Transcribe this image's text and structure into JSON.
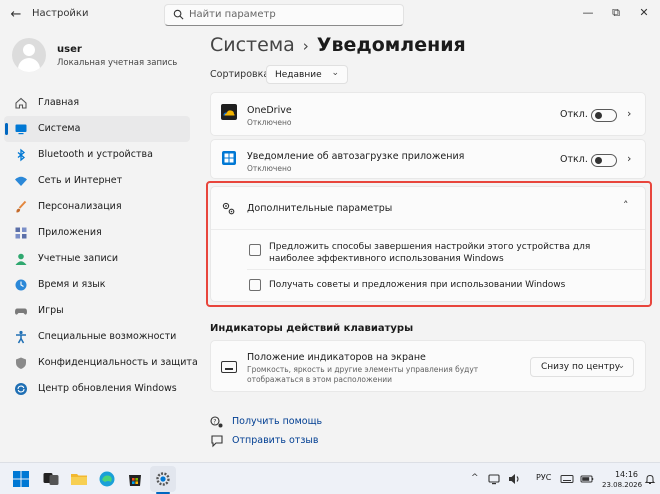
{
  "window": {
    "title": "Настройки",
    "search_placeholder": "Найти параметр",
    "controls": {
      "minimize": "—",
      "maximize": "⧉",
      "close": "✕"
    }
  },
  "user": {
    "name": "user",
    "account_type": "Локальная учетная запись"
  },
  "sidebar": {
    "items": [
      {
        "label": "Главная",
        "icon": "home-icon",
        "color": "#555555"
      },
      {
        "label": "Система",
        "icon": "system-icon",
        "color": "#0078d4",
        "active": true
      },
      {
        "label": "Bluetooth и устройства",
        "icon": "bluetooth-icon",
        "color": "#0078d4"
      },
      {
        "label": "Сеть и Интернет",
        "icon": "network-icon",
        "color": "#2b88d8"
      },
      {
        "label": "Персонализация",
        "icon": "brush-icon",
        "color": "#e3873e"
      },
      {
        "label": "Приложения",
        "icon": "apps-icon",
        "color": "#5b6fa8"
      },
      {
        "label": "Учетные записи",
        "icon": "accounts-icon",
        "color": "#2fa86f"
      },
      {
        "label": "Время и язык",
        "icon": "time-language-icon",
        "color": "#2b88d8"
      },
      {
        "label": "Игры",
        "icon": "gaming-icon",
        "color": "#7a7a7a"
      },
      {
        "label": "Специальные возможности",
        "icon": "accessibility-icon",
        "color": "#1f6fb4"
      },
      {
        "label": "Конфиденциальность и защита",
        "icon": "privacy-shield-icon",
        "color": "#7a7a7a"
      },
      {
        "label": "Центр обновления Windows",
        "icon": "windows-update-icon",
        "color": "#1f6fb4"
      }
    ]
  },
  "main": {
    "breadcrumb": {
      "parent": "Система",
      "separator": "›",
      "current": "Уведомления"
    },
    "sort": {
      "label": "Сортировка:",
      "value": "Недавние"
    },
    "apps": [
      {
        "name": "OneDrive",
        "status": "Отключено",
        "toggle_label": "Откл.",
        "toggle_on": false
      },
      {
        "name": "Уведомление об автозагрузке приложения",
        "status": "Отключено",
        "toggle_label": "Откл.",
        "toggle_on": false
      }
    ],
    "additional": {
      "title": "Дополнительные параметры",
      "options": [
        {
          "label": "Предложить способы завершения настройки этого устройства для наиболее эффективного использования Windows",
          "checked": false
        },
        {
          "label": "Получать советы и предложения при использовании Windows",
          "checked": false
        }
      ]
    },
    "keyboard": {
      "section_title": "Индикаторы действий клавиатуры",
      "setting_title": "Положение индикаторов на экране",
      "setting_desc": "Громкость, яркость и другие элементы управления будут отображаться в этом расположении",
      "value": "Снизу по центру"
    },
    "help": {
      "get_help": "Получить помощь",
      "feedback": "Отправить отзыв"
    }
  },
  "taskbar": {
    "tray_arrow": "^",
    "language": "РУС",
    "time": "14:16",
    "date": "23.08.2026"
  },
  "colors": {
    "accent": "#0067c0",
    "highlight_border": "#e8453c",
    "link": "#003e92"
  }
}
